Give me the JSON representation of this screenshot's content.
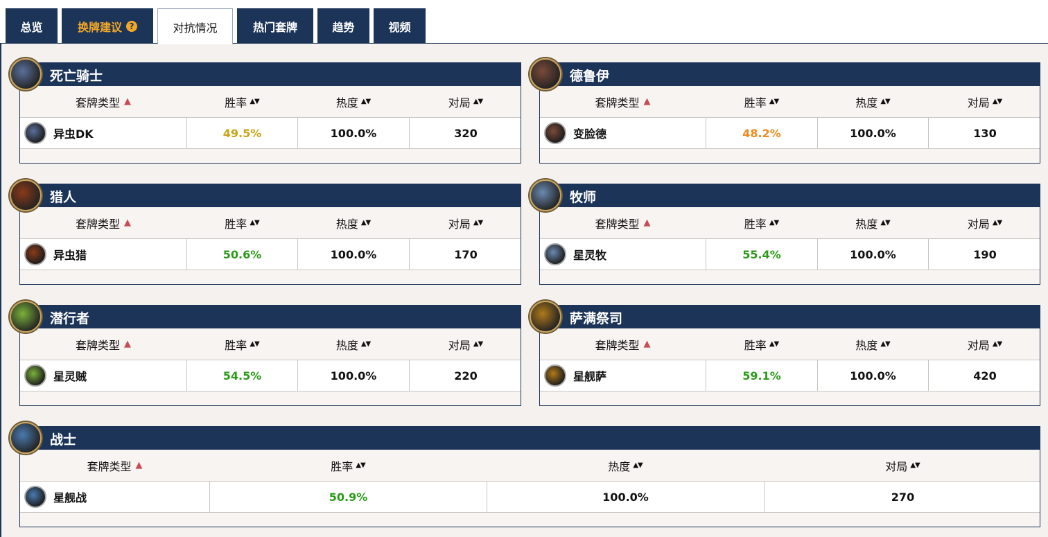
{
  "tabs": [
    {
      "label": "总览"
    },
    {
      "label": "换牌建议",
      "help_icon": "question-circle-icon"
    },
    {
      "label": "对抗情况"
    },
    {
      "label": "热门套牌"
    },
    {
      "label": "趋势"
    },
    {
      "label": "视频"
    }
  ],
  "colors": {
    "header_navy": "#1c3458",
    "winrate_green": "#2a9a17",
    "winrate_gold": "#c9a516",
    "winrate_orange": "#f2891d",
    "sort_red": "#c94b55",
    "tab_gold": "#f3a827"
  },
  "columns": {
    "deck_type": "套牌类型",
    "winrate": "胜率",
    "popularity": "热度",
    "games": "对局"
  },
  "classes": [
    {
      "name": "死亡骑士",
      "icon": "death-knight-icon",
      "emblem_color": "#5a6f9a",
      "deck": {
        "name": "异虫DK",
        "icon": "death-knight-deck-icon",
        "winrate": "49.5%",
        "winrate_class": "gold",
        "popularity": "100.0%",
        "games": "320"
      }
    },
    {
      "name": "德鲁伊",
      "icon": "druid-icon",
      "emblem_color": "#7a4a3a",
      "deck": {
        "name": "变脸德",
        "icon": "druid-deck-icon",
        "winrate": "48.2%",
        "winrate_class": "orange",
        "popularity": "100.0%",
        "games": "130"
      }
    },
    {
      "name": "猎人",
      "icon": "hunter-icon",
      "emblem_color": "#8a3a1a",
      "deck": {
        "name": "异虫猎",
        "icon": "hunter-deck-icon",
        "winrate": "50.6%",
        "winrate_class": "green",
        "popularity": "100.0%",
        "games": "170"
      }
    },
    {
      "name": "牧师",
      "icon": "priest-icon",
      "emblem_color": "#6a8ab0",
      "deck": {
        "name": "星灵牧",
        "icon": "priest-deck-icon",
        "winrate": "55.4%",
        "winrate_class": "green",
        "popularity": "100.0%",
        "games": "190"
      }
    },
    {
      "name": "潜行者",
      "icon": "rogue-icon",
      "emblem_color": "#7ab23a",
      "deck": {
        "name": "星灵贼",
        "icon": "rogue-deck-icon",
        "winrate": "54.5%",
        "winrate_class": "green",
        "popularity": "100.0%",
        "games": "220"
      }
    },
    {
      "name": "萨满祭司",
      "icon": "shaman-icon",
      "emblem_color": "#b07a1a",
      "deck": {
        "name": "星舰萨",
        "icon": "shaman-deck-icon",
        "winrate": "59.1%",
        "winrate_class": "green",
        "popularity": "100.0%",
        "games": "420"
      }
    },
    {
      "name": "战士",
      "icon": "warrior-icon",
      "emblem_color": "#4a7ab0",
      "deck": {
        "name": "星舰战",
        "icon": "warrior-deck-icon",
        "winrate": "50.9%",
        "winrate_class": "green",
        "popularity": "100.0%",
        "games": "270"
      }
    }
  ]
}
